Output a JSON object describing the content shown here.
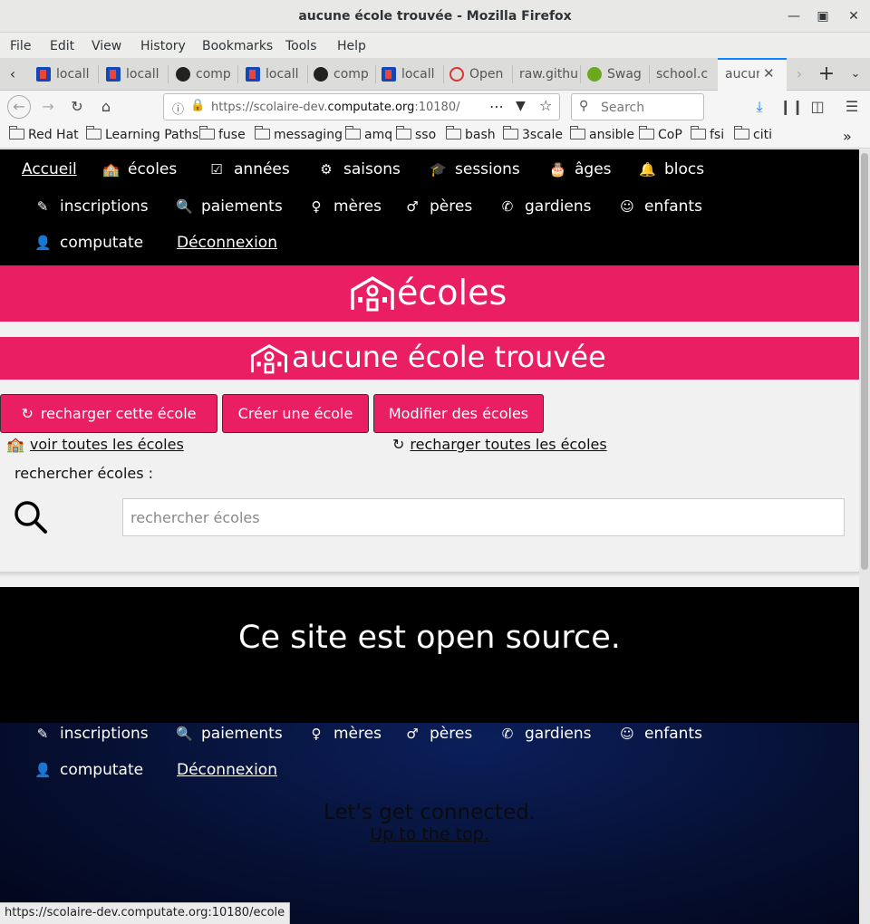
{
  "window": {
    "title": "aucune école trouvée - Mozilla Firefox"
  },
  "menu": [
    "File",
    "Edit",
    "View",
    "History",
    "Bookmarks",
    "Tools",
    "Help"
  ],
  "tabs": [
    "locall",
    "locall",
    "comp",
    "locall",
    "comp",
    "locall",
    "Open",
    "raw.githu",
    "Swag",
    "school.c",
    "aucun"
  ],
  "navbar": {
    "url_prefix": "https://scolaire-dev.",
    "url_domain": "computate.org",
    "url_suffix": ":10180/",
    "search_placeholder": "Search"
  },
  "bookmarks": [
    "Red Hat",
    "Learning Paths",
    "fuse",
    "messaging",
    "amq",
    "sso",
    "bash",
    "3scale",
    "ansible",
    "CoP",
    "fsi",
    "citi"
  ],
  "site_nav": {
    "accueil": "Accueil",
    "ecoles": "écoles",
    "annees": "années",
    "saisons": "saisons",
    "sessions": "sessions",
    "ages": "âges",
    "blocs": "blocs",
    "inscriptions": "inscriptions",
    "paiements": "paiements",
    "meres": "mères",
    "peres": "pères",
    "gardiens": "gardiens",
    "enfants": "enfants",
    "computate": "computate",
    "deconnexion": "Déconnexion"
  },
  "page": {
    "banner_title": "écoles",
    "heading": "aucune école trouvée",
    "buttons": {
      "reload": "recharger cette école",
      "create": "Créer une école",
      "modify": "Modifier des écoles"
    },
    "links": {
      "view_all": "voir toutes les écoles",
      "reload_all": "recharger toutes les écoles"
    },
    "search_label": "rechercher écoles :",
    "search_placeholder": "rechercher écoles"
  },
  "footer": {
    "open_source": "Ce site est open source.",
    "connected": "Let's get connected.",
    "up_to_top": "Up to the top."
  },
  "status_url": "https://scolaire-dev.computate.org:10180/ecole",
  "colors": {
    "accent": "#e91e63",
    "nav_bg": "#000000",
    "footer_navy": "#061033"
  }
}
